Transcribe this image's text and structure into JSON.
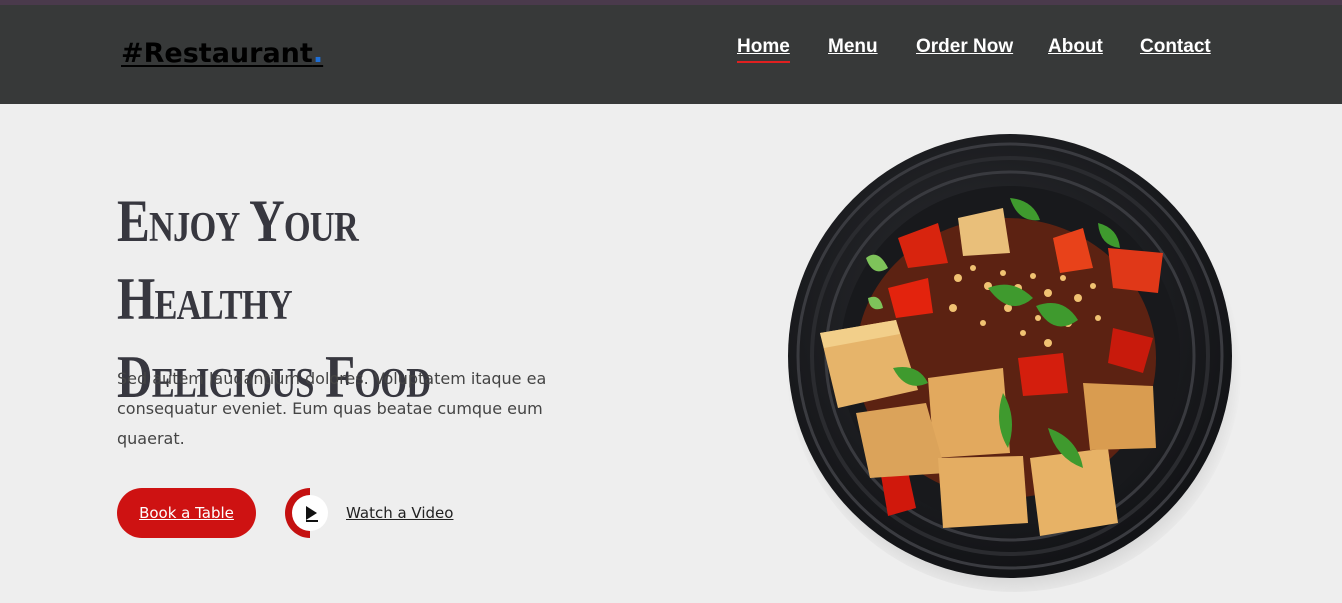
{
  "brand": {
    "name": "#Restaurant",
    "dot": "."
  },
  "nav": {
    "items": [
      {
        "label": "Home",
        "active": true
      },
      {
        "label": "Menu",
        "active": false
      },
      {
        "label": "Order Now",
        "active": false
      },
      {
        "label": "About",
        "active": false
      },
      {
        "label": "Contact",
        "active": false
      }
    ]
  },
  "hero": {
    "title_line1": "Enjoy Your Healthy",
    "title_line2": "Delicious Food",
    "description": "Sed autem laudantium dolores. Voluptatem itaque ea consequatur eveniet. Eum quas beatae cumque eum quaerat.",
    "book_label": "Book a Table",
    "video_label": "Watch a Video",
    "image_desc": "plate-of-tofu-and-peppers"
  },
  "icons": {
    "play": "play-icon"
  },
  "colors": {
    "accent": "#ce1212",
    "header_bg": "#373939",
    "page_bg": "#eeeeee",
    "logo_dot": "#1f6fd6"
  }
}
